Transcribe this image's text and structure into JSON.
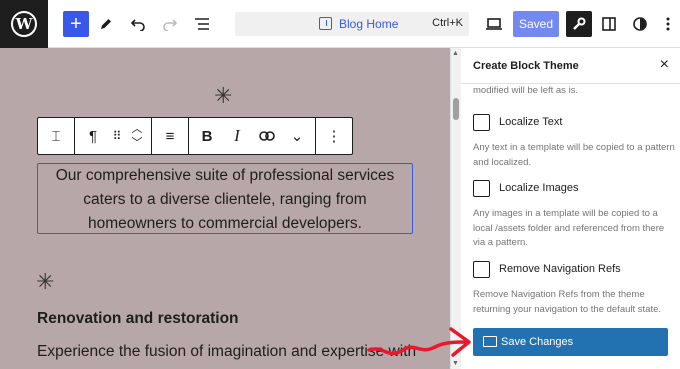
{
  "topbar": {
    "logo_letter": "W",
    "add_block": "+",
    "document_title": "Blog Home",
    "shortcut": "Ctrl+K",
    "saved_label": "Saved",
    "icons": [
      "wordpress-logo",
      "plus-icon",
      "pencil-icon",
      "undo-icon",
      "redo-icon",
      "list-view-icon",
      "template-icon",
      "desktop-view-icon",
      "settings-wrench-icon",
      "sidebar-toggle-icon",
      "styles-contrast-icon",
      "more-vertical-icon"
    ]
  },
  "canvas": {
    "background": "#b7a7a8",
    "asterisk": "✳",
    "paragraph": "Our comprehensive suite of professional services caters to a diverse clientele, ranging from homeowners to commercial developers.",
    "heading": "Renovation and restoration",
    "body_text": "Experience the fusion of imagination and expertise with"
  },
  "block_toolbar": {
    "transform": "⌶",
    "paragraph": "¶",
    "drag": "⠿",
    "move_up": "︿",
    "move_down": "﹀",
    "align": "≡",
    "bold": "B",
    "italic": "I",
    "link": "⊂⊃",
    "more_rich": "⌄",
    "options": "⋮"
  },
  "sidebar": {
    "title": "Create Block Theme",
    "close": "×",
    "fragment": "modified will be left as is.",
    "options": [
      {
        "label": "Localize Text",
        "checked": false,
        "help": "Any text in a template will be copied to a pattern and localized."
      },
      {
        "label": "Localize Images",
        "checked": false,
        "help": "Any images in a template will be copied to a local /assets folder and referenced from there via a pattern."
      },
      {
        "label": "Remove Navigation Refs",
        "checked": false,
        "help": "Remove Navigation Refs from the theme returning your navigation to the default state."
      }
    ],
    "save_button": "Save Changes",
    "accent": "#2271b1"
  },
  "annotation": {
    "arrow_color": "#e8192c"
  }
}
